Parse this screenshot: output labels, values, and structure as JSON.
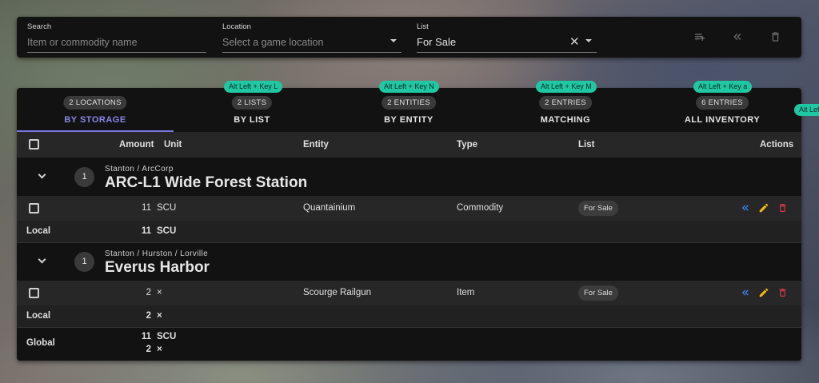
{
  "search": {
    "label": "Search",
    "placeholder": "Item or commodity name"
  },
  "location": {
    "label": "Location",
    "placeholder": "Select a game location"
  },
  "list": {
    "label": "List",
    "value": "For Sale"
  },
  "toolbar": {
    "icons": [
      "playlist-add-icon",
      "double-chevron-left-icon",
      "trash-icon"
    ]
  },
  "tabs": [
    {
      "chip": "2 LOCATIONS",
      "label": "BY STORAGE",
      "shortcut": ""
    },
    {
      "chip": "2 LISTS",
      "label": "BY LIST",
      "shortcut": "Alt Left + Key L"
    },
    {
      "chip": "2 ENTITIES",
      "label": "BY ENTITY",
      "shortcut": "Alt Left + Key N"
    },
    {
      "chip": "2 ENTRIES",
      "label": "MATCHING",
      "shortcut": "Alt Left + Key M"
    },
    {
      "chip": "6 ENTRIES",
      "label": "ALL INVENTORY",
      "shortcut": "Alt Left + Key a"
    }
  ],
  "extra_shortcut": "Alt Left",
  "table": {
    "headers": {
      "amount": "Amount",
      "unit": "Unit",
      "entity": "Entity",
      "type": "Type",
      "list": "List",
      "actions": "Actions"
    },
    "groups": [
      {
        "count": "1",
        "breadcrumb": "Stanton  /  ArcCorp",
        "title": "ARC-L1 Wide Forest Station",
        "item": {
          "amount": "11",
          "unit": "SCU",
          "entity": "Quantainium",
          "type": "Commodity",
          "list": "For Sale"
        },
        "local": {
          "label": "Local",
          "amount": "11",
          "unit": "SCU"
        }
      },
      {
        "count": "1",
        "breadcrumb": "Stanton  /  Hurston  /  Lorville",
        "title": "Everus Harbor",
        "item": {
          "amount": "2",
          "unit": "×",
          "entity": "Scourge Railgun",
          "type": "Item",
          "list": "For Sale"
        },
        "local": {
          "label": "Local",
          "amount": "2",
          "unit": "×"
        }
      }
    ],
    "global": {
      "label": "Global",
      "amount1": "11",
      "unit1": "SCU",
      "amount2": "2",
      "unit2": "×"
    }
  },
  "colors": {
    "accent": "#7b76e0",
    "shortcut": "#20c7a3",
    "move": "#3d8bff",
    "edit": "#f2b90c",
    "delete": "#e53950"
  }
}
